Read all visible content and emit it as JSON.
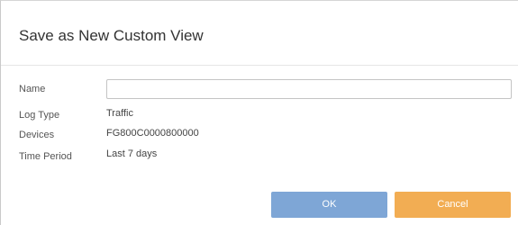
{
  "dialog": {
    "title": "Save as New Custom View"
  },
  "form": {
    "name": {
      "label": "Name",
      "value": "",
      "placeholder": ""
    },
    "log_type": {
      "label": "Log Type",
      "value": "Traffic"
    },
    "devices": {
      "label": "Devices",
      "value": "FG800C0000800000"
    },
    "time_period": {
      "label": "Time Period",
      "value": "Last 7 days"
    }
  },
  "buttons": {
    "ok_label": "OK",
    "cancel_label": "Cancel"
  },
  "colors": {
    "ok_button": "#7ea6d6",
    "cancel_button": "#f2ad53",
    "title_text": "#333333"
  }
}
